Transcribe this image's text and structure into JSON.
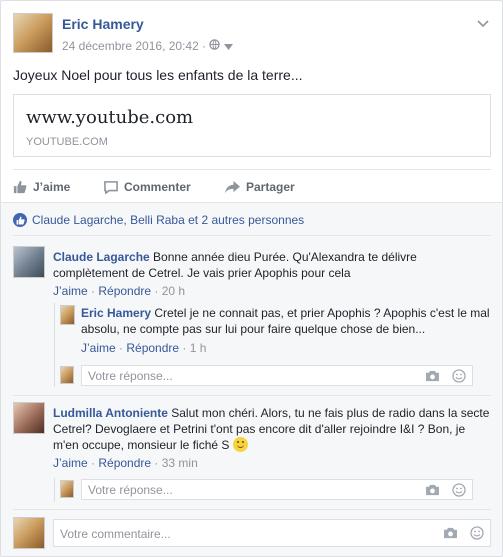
{
  "post": {
    "author": "Eric Hamery",
    "date": "24 décembre 2016, 20:42",
    "separator": "·",
    "text": "Joyeux Noel pour tous les enfants de la terre...",
    "link_title": "www.youtube.com",
    "link_domain": "YOUTUBE.COM"
  },
  "actions": {
    "like": "J’aime",
    "comment": "Commenter",
    "share": "Partager"
  },
  "reactions": {
    "summary": "Claude Lagarche, Belli Raba et 2 autres personnes"
  },
  "comments": [
    {
      "author": "Claude Lagarche",
      "text": " Bonne année dieu Purée. Qu'Alexandra te délivre complètement de Cetrel. Je vais prier Apophis pour cela",
      "like": "J’aime",
      "dot": " · ",
      "reply": "Répondre",
      "time": "20 h",
      "replies": [
        {
          "author": "Eric Hamery",
          "text": " Cretel je ne connait pas, et prier Apophis ? Apophis c'est le mal absolu, ne compte pas sur lui pour faire quelque chose de bien...",
          "like": "J’aime",
          "reply": "Répondre",
          "time": "1 h"
        }
      ],
      "reply_placeholder": "Votre réponse..."
    },
    {
      "author": "Ludmilla Antoniente",
      "text": " Salut mon chéri. Alors, tu ne fais plus de radio dans la secte Cetrel? Devoglaere et Petrini t'ont pas encore dit d'aller rejoindre I&I ? Bon, je m'en occupe, monsieur le fiché S ",
      "like": "J’aime",
      "reply": "Répondre",
      "time": "33 min",
      "reply_placeholder": "Votre réponse..."
    }
  ],
  "comment_input": {
    "placeholder": "Votre commentaire..."
  },
  "colors": {
    "link": "#365899",
    "like_blue": "#4267b2",
    "muted": "#90949c"
  }
}
